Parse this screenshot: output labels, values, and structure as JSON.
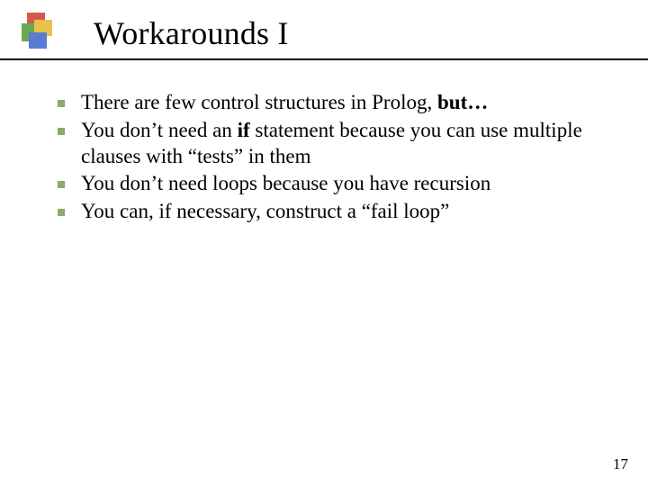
{
  "title": "Workarounds I",
  "bullets": [
    {
      "pre": "There are few control structures in Prolog, ",
      "bold": "but…"
    },
    {
      "pre": "You don’t need an ",
      "bold": "if",
      "post": " statement because you can use multiple clauses with “tests” in them"
    },
    {
      "text": "You don’t need loops because you have recursion"
    },
    {
      "text": "You can, if necessary, construct a “fail loop”"
    }
  ],
  "page_number": "17"
}
